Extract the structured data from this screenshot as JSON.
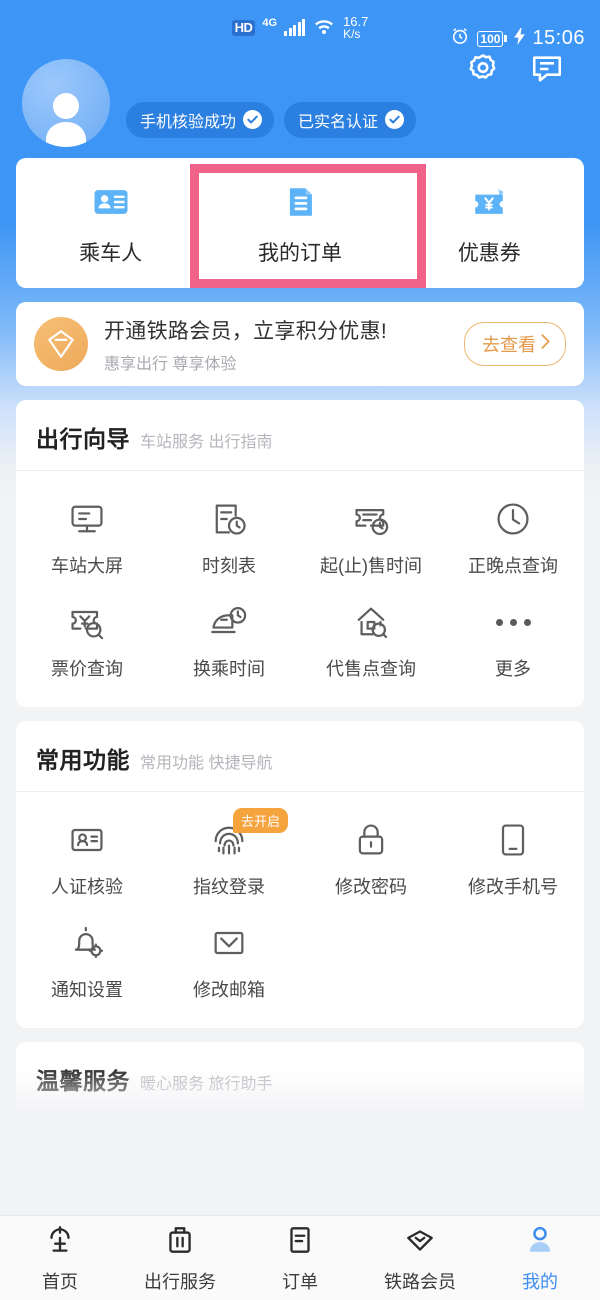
{
  "status_bar": {
    "hd_label": "HD",
    "network_type": "4G",
    "speed_value": "16.7",
    "speed_unit": "K/s",
    "battery_level": "100",
    "time": "15:06",
    "icons": [
      "alarm-clock-icon",
      "battery-icon",
      "charging-bolt-icon",
      "settings-gear-icon",
      "message-icon"
    ]
  },
  "profile": {
    "avatar_alt": "default-user-avatar",
    "badges": [
      {
        "label": "手机核验成功",
        "icon": "check-circle-icon"
      },
      {
        "label": "已实名认证",
        "icon": "check-circle-icon"
      }
    ]
  },
  "quick_actions": {
    "items": [
      {
        "label": "乘车人",
        "icon": "id-card-icon",
        "highlighted": false
      },
      {
        "label": "我的订单",
        "icon": "order-document-icon",
        "highlighted": true
      },
      {
        "label": "优惠券",
        "icon": "coupon-wallet-icon",
        "highlighted": false
      }
    ],
    "highlight_color": "#f2638a"
  },
  "member_banner": {
    "icon": "diamond-gem-icon",
    "title": "开通铁路会员，立享积分优惠!",
    "subtitle": "惠享出行 尊享体验",
    "button_label": "去查看",
    "button_icon": "chevron-right-icon",
    "accent_color": "#e49a4a"
  },
  "sections": [
    {
      "title": "出行向导",
      "subtitle": "车站服务 出行指南",
      "items": [
        {
          "label": "车站大屏",
          "icon": "station-screen-icon"
        },
        {
          "label": "时刻表",
          "icon": "timetable-clock-icon"
        },
        {
          "label": "起(止)售时间",
          "icon": "ticket-clock-icon"
        },
        {
          "label": "正晚点查询",
          "icon": "clock-icon"
        },
        {
          "label": "票价查询",
          "icon": "ticket-search-icon"
        },
        {
          "label": "换乘时间",
          "icon": "train-clock-icon"
        },
        {
          "label": "代售点查询",
          "icon": "house-search-icon"
        },
        {
          "label": "更多",
          "icon": "more-dots-icon"
        }
      ]
    },
    {
      "title": "常用功能",
      "subtitle": "常用功能 快捷导航",
      "items": [
        {
          "label": "人证核验",
          "icon": "id-verify-icon"
        },
        {
          "label": "指纹登录",
          "icon": "fingerprint-icon",
          "tag": "去开启"
        },
        {
          "label": "修改密码",
          "icon": "lock-icon"
        },
        {
          "label": "修改手机号",
          "icon": "phone-icon"
        },
        {
          "label": "通知设置",
          "icon": "bell-settings-icon"
        },
        {
          "label": "修改邮箱",
          "icon": "envelope-icon"
        }
      ]
    },
    {
      "title": "温馨服务",
      "subtitle": "暖心服务 旅行助手",
      "items": []
    }
  ],
  "bottom_nav": {
    "items": [
      {
        "label": "首页",
        "icon": "railway-logo-icon",
        "active": false
      },
      {
        "label": "出行服务",
        "icon": "suitcase-icon",
        "active": false
      },
      {
        "label": "订单",
        "icon": "order-list-icon",
        "active": false
      },
      {
        "label": "铁路会员",
        "icon": "diamond-icon",
        "active": false
      },
      {
        "label": "我的",
        "icon": "person-icon",
        "active": true
      }
    ],
    "active_color": "#3f8ef0"
  }
}
